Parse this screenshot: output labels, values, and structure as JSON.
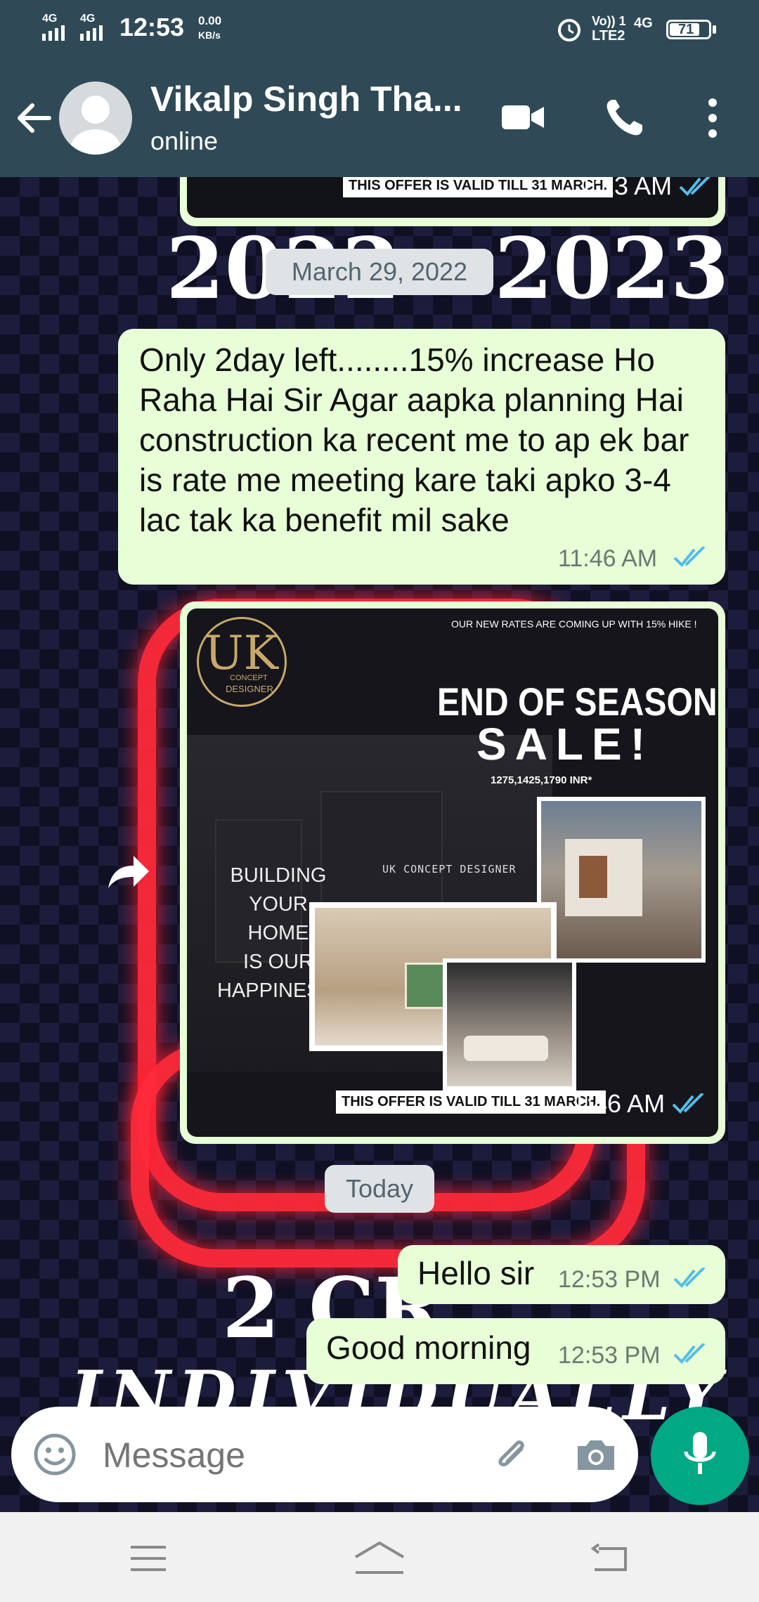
{
  "status_bar": {
    "signal1": "4G",
    "signal2": "4G",
    "time": "12:53",
    "speed": "0.00",
    "speed_unit": "KB/s",
    "volte": "Vo)) 1",
    "lte": "LTE2",
    "net": "4G",
    "battery": "71"
  },
  "header": {
    "contact_name": "Vikalp Singh Tha...",
    "status": "online"
  },
  "wallpaper_text": {
    "year": "2022 - 2023",
    "crore": "2 CR",
    "individually": "INDIVIDUALLY"
  },
  "messages": {
    "prev_offer_caption": "THIS OFFER IS VALID TILL 31 MARCH.",
    "prev_time": "1:13 AM",
    "date_chip": "March 29, 2022",
    "text1": "Only 2day left........15% increase Ho Raha Hai Sir Agar aapka planning Hai construction ka recent me to ap ek bar is rate me meeting kare taki apko 3-4 lac tak ka benefit mil sake",
    "text1_time": "11:46 AM",
    "image_time": "1:46 AM",
    "today_chip": "Today",
    "hello": "Hello sir",
    "hello_time": "12:53 PM",
    "good_morning": "Good morning",
    "good_morning_time": "12:53 PM"
  },
  "poster": {
    "top_note": "OUR NEW RATES ARE COMING UP WITH 15% HIKE !",
    "logo": "UK",
    "logo_sub1": "CONCEPT",
    "logo_sub2": "DESIGNER",
    "headline1": "END OF SEASON",
    "headline2": "SALE!",
    "rates": "1275,1425,1790 INR*",
    "brand": "UK CONCEPT DESIGNER",
    "slogan": [
      "BUILDING",
      "YOUR",
      "HOME",
      "IS OUR",
      "HAPPINESS."
    ],
    "offer": "THIS OFFER IS VALID TILL 31 MARCH."
  },
  "composer": {
    "placeholder": "Message"
  },
  "colors": {
    "header_bg": "#2f4a56",
    "bubble_bg": "#e7fed6",
    "accent_green": "#00a884",
    "read_ticks": "#53bdeb"
  }
}
